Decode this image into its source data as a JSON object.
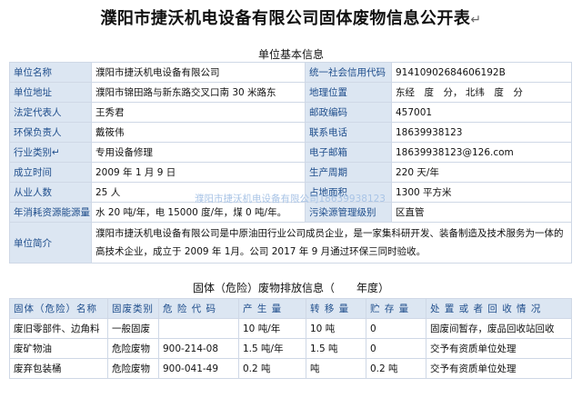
{
  "doc": {
    "title": "濮阳市捷沃机电设备有限公司固体废物信息公开表",
    "return_mark": "↵"
  },
  "basic": {
    "section_title": "单位基本信息",
    "rows": [
      {
        "l1": "单位名称",
        "v1": "濮阳市捷沃机电设备有限公司",
        "l2": "统一社会信用代码",
        "v2": "91410902684606192B"
      },
      {
        "l1": "单位地址",
        "v1": "濮阳市锦田路与新东路交叉口南 30 米路东",
        "l2": "地理位置",
        "v2": "东经　度　分，  北纬　度　分"
      },
      {
        "l1": "法定代表人",
        "v1": "王秀君",
        "l2": "邮政编码",
        "v2": "457001"
      },
      {
        "l1": "环保负责人",
        "v1": "戴筱伟",
        "l2": "联系电话",
        "v2": "18639938123"
      },
      {
        "l1": "行业类别↵",
        "v1": "专用设备修理",
        "l2": "电子邮箱",
        "v2": "18639938123@126.com"
      },
      {
        "l1": "成立时间",
        "v1": "2009 年 1 月 9 日",
        "l2": "生产周期",
        "v2": "220  天/年"
      },
      {
        "l1": "从业人数",
        "v1": "25 人",
        "l2": "占地面积",
        "v2": "1300 平方米"
      },
      {
        "l1": "年消耗资源能源量",
        "v1": "水 20 吨/年，电 15000 度/年，煤 0  吨/年。",
        "l2": "污染源管理级别",
        "v2": "区直管"
      }
    ],
    "intro_label": "单位简介",
    "intro_text": "濮阳市捷沃机电设备有限公司是中原油田行业公司成员企业，是一家集科研开发、装备制造及技术服务为一体的高技术企业，成立于 2009 年 1月。公司 2017 年 9 月通过环保三同时验收。",
    "watermark": "濮阳市捷沃机电设备有限公司18639938123"
  },
  "waste": {
    "section_title": "固体（危险）废物排放信息（　　年度）",
    "headers": [
      "固体（危险）名称",
      "固废类别",
      "危 险 代 码",
      "产 生 量",
      "转 移 量",
      "贮 存 量",
      "处 置 或 者 回 收 情 况"
    ],
    "rows": [
      [
        "废旧零部件、边角料",
        "一般固废",
        "",
        "10 吨/年",
        "10 吨",
        "0",
        "固废间暂存，废品回收站回收"
      ],
      [
        "废矿物油",
        "危险废物",
        "900-214-08",
        "1.5 吨/年",
        "1.5  吨",
        "0",
        "交予有资质单位处理"
      ],
      [
        "废弃包装桶",
        "危险废物",
        "900-041-49",
        "0.2 吨",
        "吨",
        "0.2 吨",
        "交予有资质单位处理"
      ]
    ]
  }
}
